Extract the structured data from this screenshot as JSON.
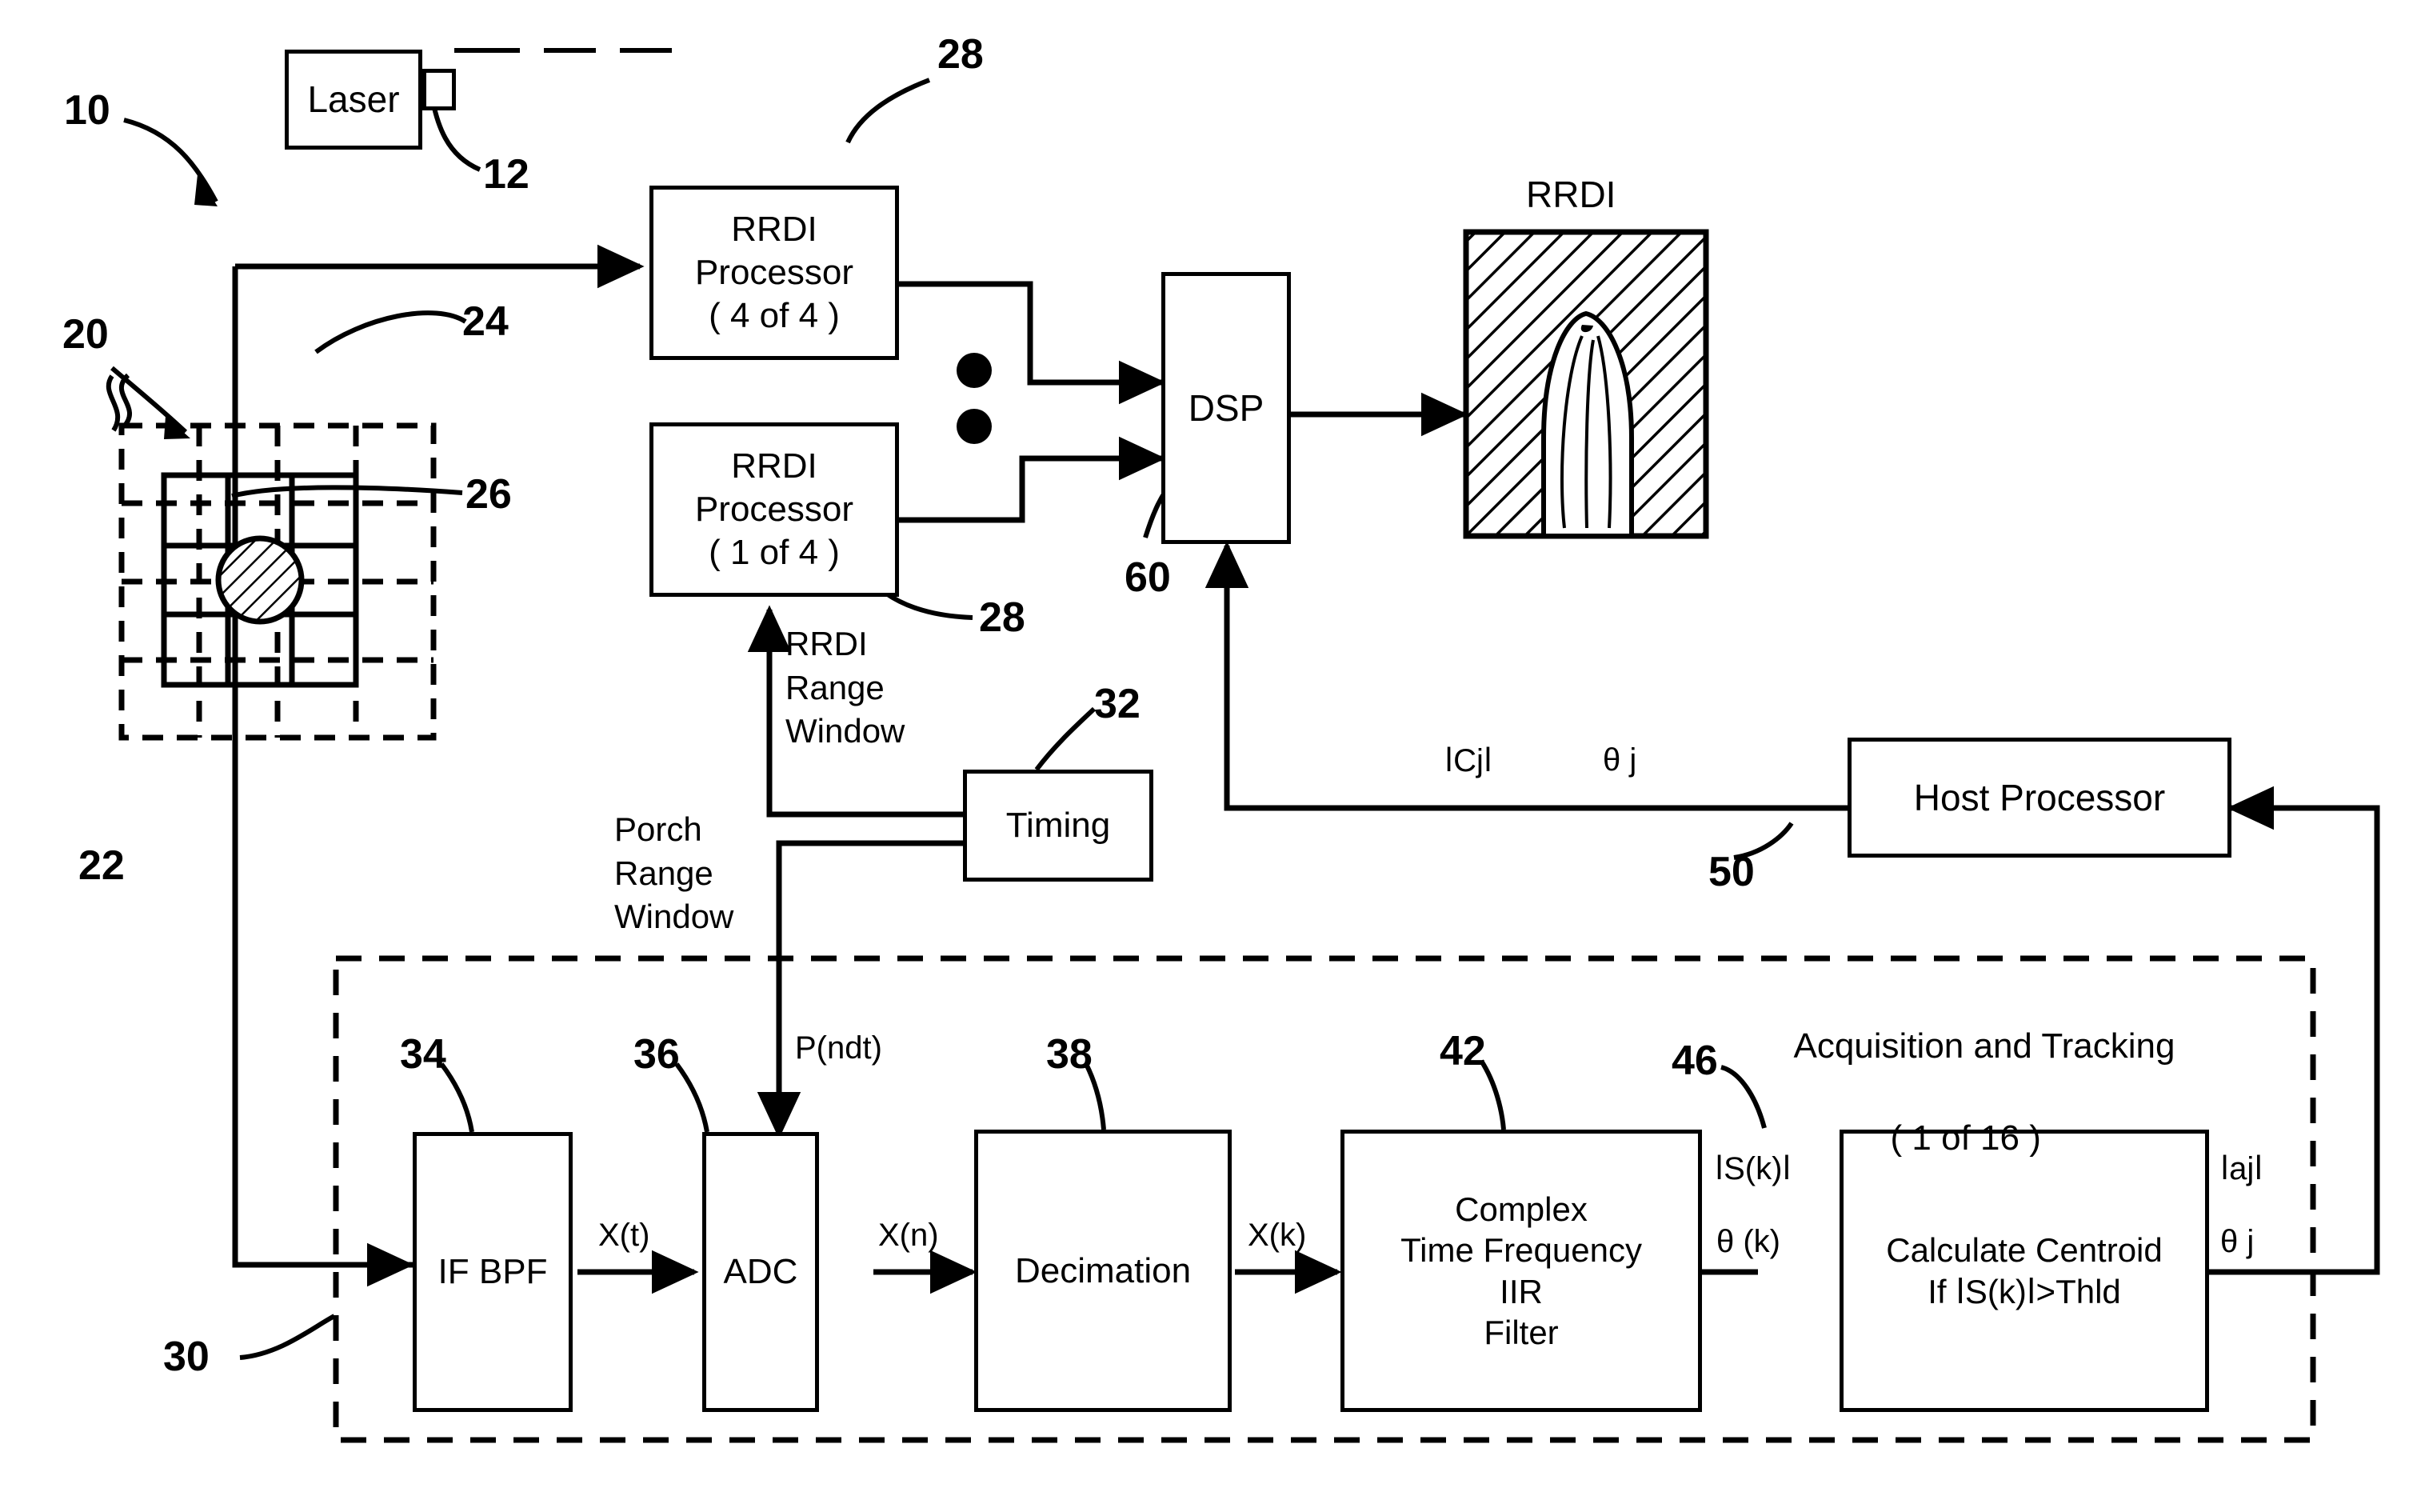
{
  "figure": {
    "type": "patent-block-diagram",
    "title_none": ""
  },
  "blocks": {
    "laser": {
      "label": "Laser"
    },
    "rrdi_proc_top": {
      "line1": "RRDI",
      "line2": "Processor",
      "line3": "( 4 of 4 )"
    },
    "rrdi_proc_bottom": {
      "line1": "RRDI",
      "line2": "Processor",
      "line3": "( 1 of 4 )"
    },
    "dsp": {
      "label": "DSP"
    },
    "timing": {
      "label": "Timing"
    },
    "host_processor": {
      "label": "Host Processor"
    },
    "if_bpf": {
      "label": "IF BPF"
    },
    "adc": {
      "label": "ADC"
    },
    "decimation": {
      "label": "Decimation"
    },
    "iir_filter": {
      "line1": "Complex",
      "line2": "Time Frequency",
      "line3": "IIR",
      "line4": "Filter"
    },
    "centroid": {
      "line1": "Calculate Centroid",
      "line2": "If ⅼS(k)ⅼ>Thld"
    }
  },
  "display": {
    "rrdi_caption": "RRDI"
  },
  "callouts": {
    "c10": "10",
    "c12": "12",
    "c20": "20",
    "c22": "22",
    "c24": "24",
    "c26": "26",
    "c28_top": "28",
    "c28_bottom": "28",
    "c30": "30",
    "c32": "32",
    "c34": "34",
    "c36": "36",
    "c38": "38",
    "c42": "42",
    "c46": "46",
    "c50": "50",
    "c60": "60"
  },
  "signal_labels": {
    "rrdi_range_window": "RRDI\nRange\nWindow",
    "porch_range_window": "Porch\nRange\nWindow",
    "p_ndt": "P(ndt)",
    "x_t": "X(t)",
    "x_n": "X(n)",
    "x_k": "X(k)",
    "s_k_mag": "ⅼS(k)ⅼ",
    "theta_k": "θ (k)",
    "a_j_mag": "ⅼajⅼ",
    "theta_j_right": "θ j",
    "c_j_mag": "ⅼCjⅼ",
    "theta_j_host": "θ j"
  },
  "group_label": {
    "line1": "Acquisition and Tracking",
    "line2": "( 1 of 16 )"
  },
  "colors": {
    "ink": "#000000",
    "paper": "#ffffff"
  }
}
